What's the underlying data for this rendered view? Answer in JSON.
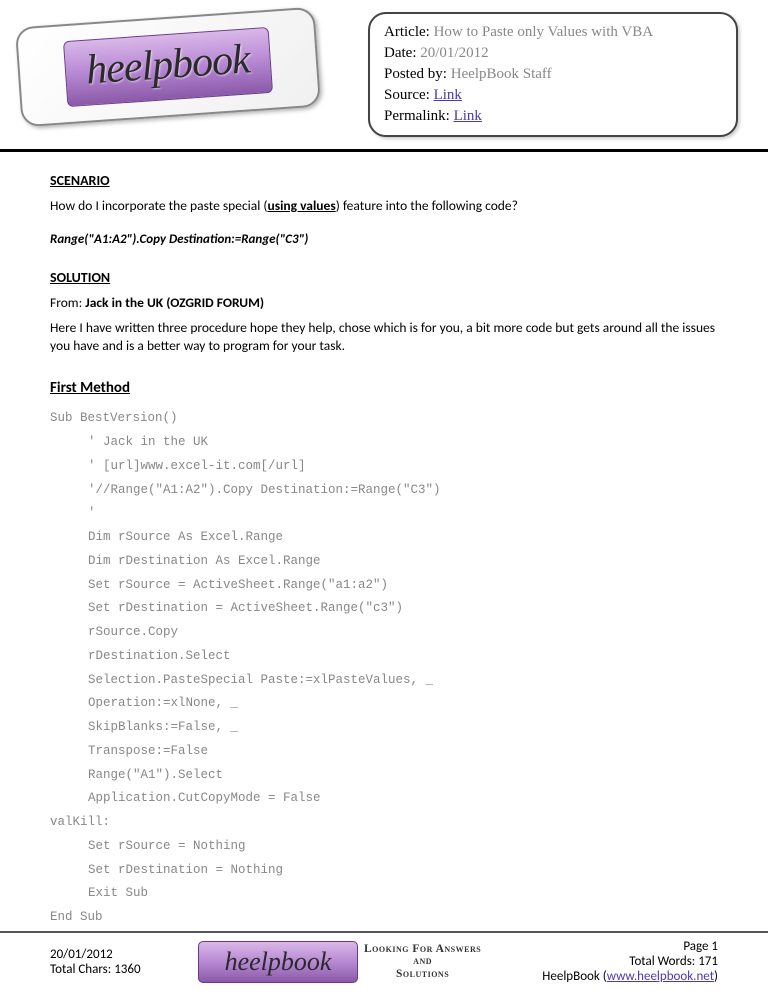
{
  "header": {
    "logo_text": "heelpbook",
    "meta": {
      "article_label": "Article",
      "article_value": "How to Paste only Values with VBA",
      "date_label": "Date",
      "date_value": "20/01/2012",
      "postedby_label": "Posted by",
      "postedby_value": "HeelpBook Staff",
      "source_label": "Source",
      "source_link": "Link",
      "permalink_label": "Permalink",
      "permalink_link": "Link"
    }
  },
  "scenario": {
    "heading": "SCENARIO",
    "question_pre": "How do I incorporate the paste special (",
    "question_em": "using values",
    "question_post": ") feature into the following code?",
    "code": "Range(\"A1:A2\").Copy Destination:=Range(\"C3\")"
  },
  "solution": {
    "heading": "SOLUTION",
    "from_label": "From: ",
    "from_author": "Jack in the UK (OZGRID FORUM)",
    "description": "Here I have written three procedure hope they help, chose which is for you, a bit more code but gets around all the issues you have and is a better way to program for your task."
  },
  "method": {
    "heading": "First Method",
    "lines": [
      {
        "i": 0,
        "t": "Sub BestVersion()"
      },
      {
        "i": 1,
        "t": "' Jack in the UK"
      },
      {
        "i": 1,
        "t": "' [url]www.excel-it.com[/url]"
      },
      {
        "i": 1,
        "t": "'//Range(\"A1:A2\").Copy Destination:=Range(\"C3\")"
      },
      {
        "i": 1,
        "t": "'"
      },
      {
        "i": 1,
        "t": "Dim rSource As Excel.Range"
      },
      {
        "i": 1,
        "t": "Dim rDestination As Excel.Range"
      },
      {
        "i": 1,
        "t": "Set rSource = ActiveSheet.Range(\"a1:a2\")"
      },
      {
        "i": 1,
        "t": "Set rDestination = ActiveSheet.Range(\"c3\")"
      },
      {
        "i": 1,
        "t": "rSource.Copy"
      },
      {
        "i": 1,
        "t": "rDestination.Select"
      },
      {
        "i": 1,
        "t": "Selection.PasteSpecial Paste:=xlPasteValues, _"
      },
      {
        "i": 1,
        "t": "Operation:=xlNone, _"
      },
      {
        "i": 1,
        "t": "SkipBlanks:=False, _"
      },
      {
        "i": 1,
        "t": "Transpose:=False"
      },
      {
        "i": 1,
        "t": "Range(\"A1\").Select"
      },
      {
        "i": 1,
        "t": "Application.CutCopyMode = False"
      },
      {
        "i": 0,
        "t": "valKill:"
      },
      {
        "i": 1,
        "t": "Set rSource = Nothing"
      },
      {
        "i": 1,
        "t": "Set rDestination = Nothing"
      },
      {
        "i": 1,
        "t": "Exit Sub"
      },
      {
        "i": 0,
        "t": "End Sub"
      }
    ]
  },
  "footer": {
    "date": "20/01/2012",
    "chars_label": "Total Chars: ",
    "chars_value": "1360",
    "logo_text": "heelpbook",
    "tagline_l1": "Looking For Answers",
    "tagline_l2": "and",
    "tagline_l3": "Solutions",
    "page_label": "Page ",
    "page_value": "1",
    "words_label": "Total Words: ",
    "words_value": "171",
    "site_label": "HeelpBook (",
    "site_url": "www.heelpbook.net",
    "site_close": ")"
  }
}
